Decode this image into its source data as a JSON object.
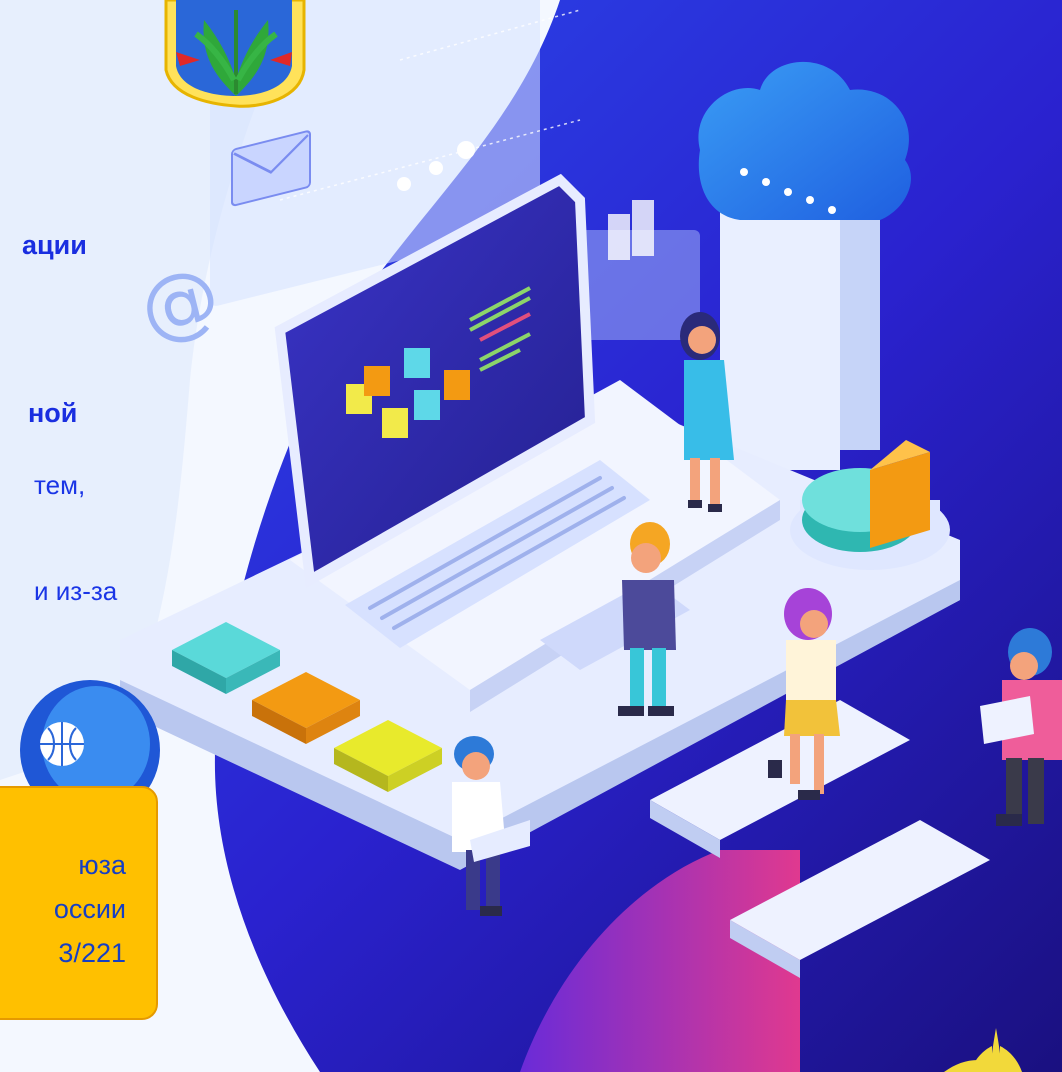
{
  "text": {
    "line1": "ации",
    "line2": "ной",
    "line3": "тем,",
    "line4": "и из-за"
  },
  "note": {
    "line1": "юза",
    "line2": "оссии",
    "line3": "3/221"
  },
  "icons": {
    "emblem": "union-emblem-icon",
    "email": "envelope-icon",
    "at": "at-sign-icon",
    "cloud": "cloud-icon",
    "globe": "globe-icon",
    "pie": "pie-chart-icon",
    "laptop": "laptop-icon"
  },
  "colors": {
    "background": "#2a2fd6",
    "note_fill": "#ffc000",
    "teal_key": "#35c9c6",
    "orange_key": "#f39a12",
    "yellow_key": "#e8ea2c",
    "text_blue": "#1a35e6"
  }
}
